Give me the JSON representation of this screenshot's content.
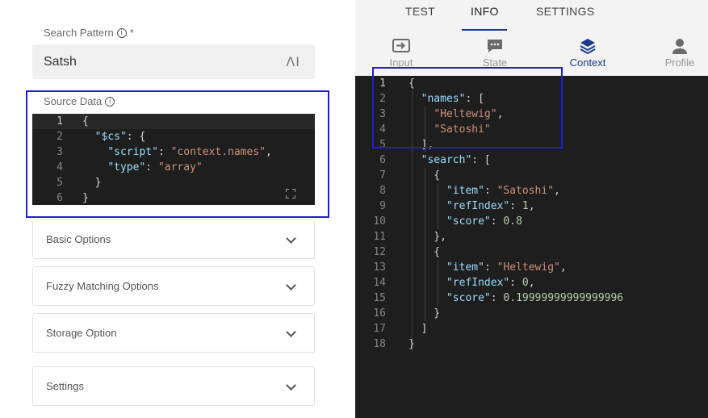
{
  "left_panel": {
    "search_pattern": {
      "label": "Search Pattern",
      "required": "*",
      "value": "Satsh",
      "ai_label": "ΛI"
    },
    "source_data": {
      "label": "Source Data",
      "lines": [
        {
          "n": "1",
          "tokens": [
            {
              "t": "{",
              "c": "p"
            }
          ]
        },
        {
          "n": "2",
          "tokens": [
            {
              "t": "  ",
              "c": "p"
            },
            {
              "t": "\"$cs\"",
              "c": "k"
            },
            {
              "t": ": {",
              "c": "p"
            }
          ]
        },
        {
          "n": "3",
          "tokens": [
            {
              "t": "    ",
              "c": "p"
            },
            {
              "t": "\"script\"",
              "c": "k"
            },
            {
              "t": ": ",
              "c": "p"
            },
            {
              "t": "\"context.names\"",
              "c": "s"
            },
            {
              "t": ",",
              "c": "p"
            }
          ]
        },
        {
          "n": "4",
          "tokens": [
            {
              "t": "    ",
              "c": "p"
            },
            {
              "t": "\"type\"",
              "c": "k"
            },
            {
              "t": ": ",
              "c": "p"
            },
            {
              "t": "\"array\"",
              "c": "s"
            }
          ]
        },
        {
          "n": "5",
          "tokens": [
            {
              "t": "  }",
              "c": "p"
            }
          ]
        },
        {
          "n": "6",
          "tokens": [
            {
              "t": "}",
              "c": "p"
            }
          ]
        }
      ]
    },
    "accordions": [
      {
        "label": "Basic Options"
      },
      {
        "label": "Fuzzy Matching Options"
      },
      {
        "label": "Storage Option"
      },
      {
        "label": "Settings"
      }
    ]
  },
  "right_panel": {
    "tabs": [
      {
        "label": "TEST"
      },
      {
        "label": "INFO",
        "active": true
      },
      {
        "label": "SETTINGS"
      }
    ],
    "subtabs": [
      {
        "label": "Input",
        "icon": "input-icon"
      },
      {
        "label": "State",
        "icon": "chat-icon"
      },
      {
        "label": "Context",
        "icon": "layers-icon",
        "active": true
      },
      {
        "label": "Profile",
        "icon": "person-icon"
      }
    ],
    "lines": [
      {
        "n": "1",
        "tokens": [
          {
            "t": "{",
            "c": "p"
          }
        ]
      },
      {
        "n": "2",
        "tokens": [
          {
            "t": "  ",
            "c": "p"
          },
          {
            "t": "\"names\"",
            "c": "k"
          },
          {
            "t": ": [",
            "c": "p"
          }
        ]
      },
      {
        "n": "3",
        "tokens": [
          {
            "t": "    ",
            "c": "p"
          },
          {
            "t": "\"Heltewig\"",
            "c": "s"
          },
          {
            "t": ",",
            "c": "p"
          }
        ]
      },
      {
        "n": "4",
        "tokens": [
          {
            "t": "    ",
            "c": "p"
          },
          {
            "t": "\"Satoshi\"",
            "c": "s"
          }
        ]
      },
      {
        "n": "5",
        "tokens": [
          {
            "t": "  ],",
            "c": "p"
          }
        ]
      },
      {
        "n": "6",
        "tokens": [
          {
            "t": "  ",
            "c": "p"
          },
          {
            "t": "\"search\"",
            "c": "k"
          },
          {
            "t": ": [",
            "c": "p"
          }
        ]
      },
      {
        "n": "7",
        "tokens": [
          {
            "t": "    {",
            "c": "p"
          }
        ]
      },
      {
        "n": "8",
        "tokens": [
          {
            "t": "      ",
            "c": "p"
          },
          {
            "t": "\"item\"",
            "c": "k"
          },
          {
            "t": ": ",
            "c": "p"
          },
          {
            "t": "\"Satoshi\"",
            "c": "s"
          },
          {
            "t": ",",
            "c": "p"
          }
        ]
      },
      {
        "n": "9",
        "tokens": [
          {
            "t": "      ",
            "c": "p"
          },
          {
            "t": "\"refIndex\"",
            "c": "k"
          },
          {
            "t": ": ",
            "c": "p"
          },
          {
            "t": "1",
            "c": "n"
          },
          {
            "t": ",",
            "c": "p"
          }
        ]
      },
      {
        "n": "10",
        "tokens": [
          {
            "t": "      ",
            "c": "p"
          },
          {
            "t": "\"score\"",
            "c": "k"
          },
          {
            "t": ": ",
            "c": "p"
          },
          {
            "t": "0.8",
            "c": "n"
          }
        ]
      },
      {
        "n": "11",
        "tokens": [
          {
            "t": "    },",
            "c": "p"
          }
        ]
      },
      {
        "n": "12",
        "tokens": [
          {
            "t": "    {",
            "c": "p"
          }
        ]
      },
      {
        "n": "13",
        "tokens": [
          {
            "t": "      ",
            "c": "p"
          },
          {
            "t": "\"item\"",
            "c": "k"
          },
          {
            "t": ": ",
            "c": "p"
          },
          {
            "t": "\"Heltewig\"",
            "c": "s"
          },
          {
            "t": ",",
            "c": "p"
          }
        ]
      },
      {
        "n": "14",
        "tokens": [
          {
            "t": "      ",
            "c": "p"
          },
          {
            "t": "\"refIndex\"",
            "c": "k"
          },
          {
            "t": ": ",
            "c": "p"
          },
          {
            "t": "0",
            "c": "n"
          },
          {
            "t": ",",
            "c": "p"
          }
        ]
      },
      {
        "n": "15",
        "tokens": [
          {
            "t": "      ",
            "c": "p"
          },
          {
            "t": "\"score\"",
            "c": "k"
          },
          {
            "t": ": ",
            "c": "p"
          },
          {
            "t": "0.19999999999999996",
            "c": "n"
          }
        ]
      },
      {
        "n": "16",
        "tokens": [
          {
            "t": "    }",
            "c": "p"
          }
        ]
      },
      {
        "n": "17",
        "tokens": [
          {
            "t": "  ]",
            "c": "p"
          }
        ]
      },
      {
        "n": "18",
        "tokens": [
          {
            "t": "}",
            "c": "p"
          }
        ]
      }
    ]
  },
  "colors": {
    "highlight_box": "#1f1fcf",
    "accent": "#1a3a8a",
    "editor_bg": "#1e1e1e"
  }
}
